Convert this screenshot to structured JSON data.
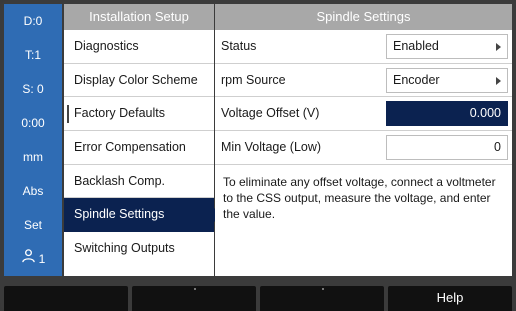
{
  "status_bar": {
    "items": [
      {
        "id": "datum",
        "label": "D:0"
      },
      {
        "id": "tool",
        "label": "T:1"
      },
      {
        "id": "spindle",
        "label": "S: 0"
      },
      {
        "id": "timer",
        "label": "0:00"
      },
      {
        "id": "units",
        "label": "mm"
      },
      {
        "id": "mode",
        "label": "Abs"
      },
      {
        "id": "set",
        "label": "Set"
      }
    ],
    "user": {
      "label": "1",
      "icon": "user-icon"
    }
  },
  "menu": {
    "header": "Installation Setup",
    "items": [
      {
        "label": "Diagnostics",
        "selected": false
      },
      {
        "label": "Display Color Scheme",
        "selected": false
      },
      {
        "label": "Factory Defaults",
        "selected": false
      },
      {
        "label": "Error Compensation",
        "selected": false
      },
      {
        "label": "Backlash Comp.",
        "selected": false
      },
      {
        "label": "Spindle Settings",
        "selected": true
      },
      {
        "label": "Switching Outputs",
        "selected": false
      }
    ]
  },
  "settings": {
    "header": "Spindle Settings",
    "rows": [
      {
        "label": "Status",
        "value": "Enabled",
        "kind": "dropdown"
      },
      {
        "label": "rpm Source",
        "value": "Encoder",
        "kind": "dropdown"
      },
      {
        "label": "Voltage Offset (V)",
        "value": "0.000",
        "kind": "number",
        "active": true
      },
      {
        "label": "Min Voltage (Low)",
        "value": "0",
        "kind": "number"
      }
    ],
    "help": "To eliminate any offset voltage, connect a voltmeter to the CSS output, measure the voltage, and enter the value."
  },
  "softkeys": [
    {
      "label": ""
    },
    {
      "label": ""
    },
    {
      "label": ""
    },
    {
      "label": "Help"
    }
  ],
  "colors": {
    "sidebar": "#2f6cb4",
    "selection": "#0b2250",
    "header": "#a8a8a8",
    "background": "#3b3b3b"
  }
}
